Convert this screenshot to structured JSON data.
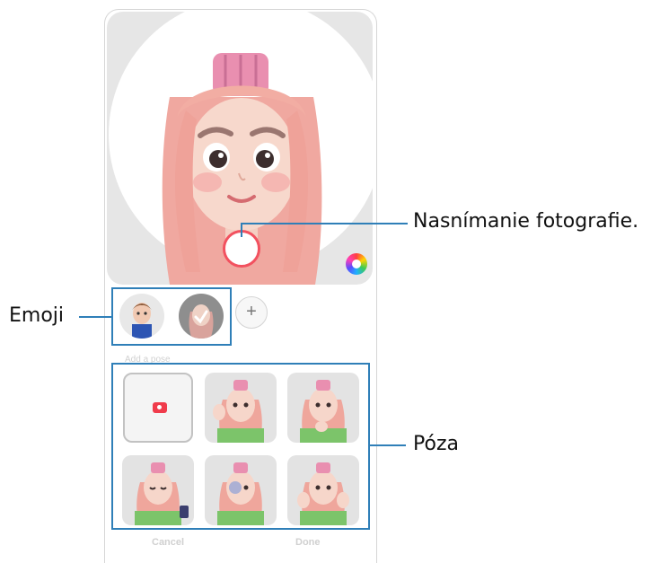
{
  "callouts": {
    "capture": "Nasnímanie fotografie.",
    "emoji": "Emoji",
    "pose": "Póza"
  },
  "controls": {
    "add_emoji_symbol": "+",
    "add_pose_label": "Add a pose",
    "cancel_label": "Cancel",
    "done_label": "Done"
  },
  "icons": {
    "shutter": "capture-button",
    "palette": "color-palette-icon",
    "camera": "camera-icon",
    "add": "plus-icon"
  },
  "colors": {
    "accent_frame": "#2f7fb8",
    "shutter_ring": "#f2515f",
    "camera_icon": "#f03b4b"
  }
}
